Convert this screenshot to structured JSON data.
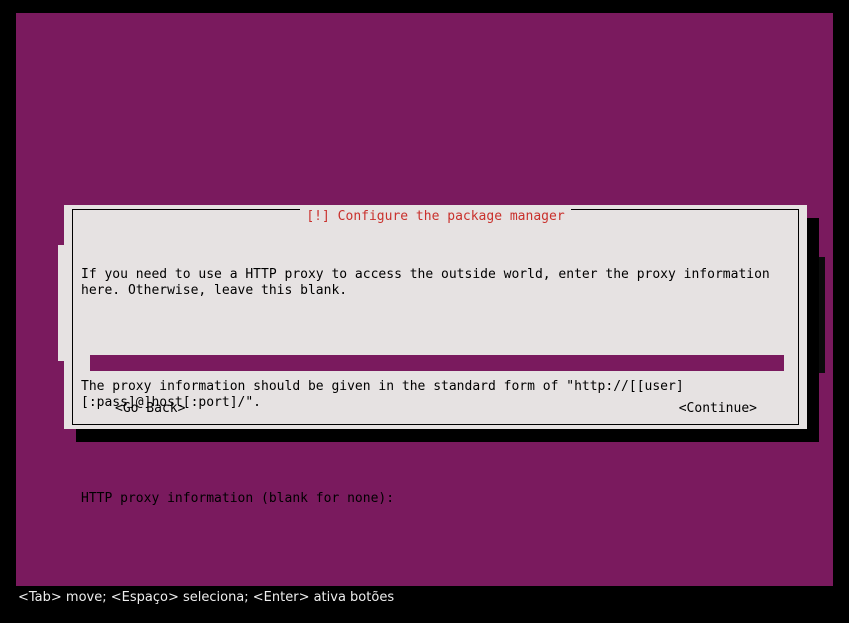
{
  "dialog": {
    "title": "[!] Configure the package manager",
    "body_line1": "If you need to use a HTTP proxy to access the outside world, enter the proxy information here. Otherwise, leave this blank.",
    "body_line2": "The proxy information should be given in the standard form of \"http://[[user][:pass]@]host[:port]/\".",
    "prompt": "HTTP proxy information (blank for none):",
    "input_value": "",
    "go_back_label": "<Go Back>",
    "continue_label": "<Continue>"
  },
  "statusbar": {
    "text": "<Tab> move; <Espaço> seleciona; <Enter> ativa botões"
  }
}
